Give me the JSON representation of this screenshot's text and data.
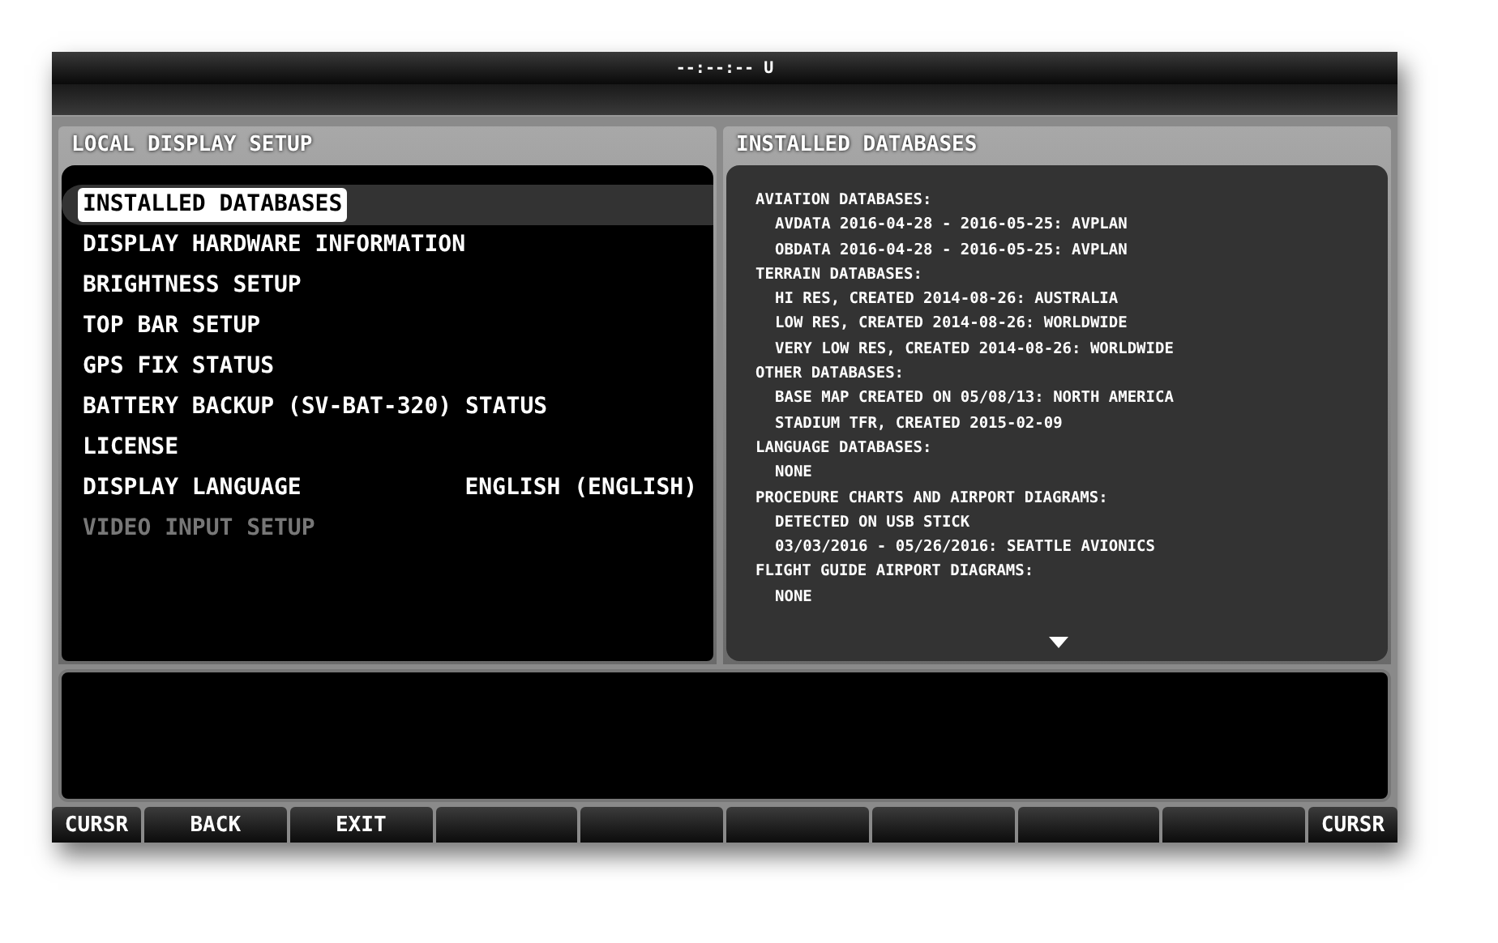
{
  "top_bar": {
    "clock": "--:--:-- U"
  },
  "left_panel": {
    "title": "LOCAL DISPLAY SETUP",
    "items": [
      {
        "label": "INSTALLED DATABASES",
        "selected": true,
        "disabled": false
      },
      {
        "label": "DISPLAY HARDWARE INFORMATION",
        "selected": false,
        "disabled": false
      },
      {
        "label": "BRIGHTNESS SETUP",
        "selected": false,
        "disabled": false
      },
      {
        "label": "TOP BAR SETUP",
        "selected": false,
        "disabled": false
      },
      {
        "label": "GPS FIX STATUS",
        "selected": false,
        "disabled": false
      },
      {
        "label": "BATTERY BACKUP (SV-BAT-320) STATUS",
        "selected": false,
        "disabled": false
      },
      {
        "label": "LICENSE",
        "selected": false,
        "disabled": false
      },
      {
        "label": "DISPLAY LANGUAGE",
        "value": "ENGLISH (ENGLISH)",
        "selected": false,
        "disabled": false
      },
      {
        "label": "VIDEO INPUT SETUP",
        "selected": false,
        "disabled": true
      }
    ]
  },
  "right_panel": {
    "title": "INSTALLED DATABASES",
    "lines": [
      {
        "kind": "heading",
        "text": "AVIATION DATABASES:"
      },
      {
        "kind": "entry",
        "text": "AVDATA 2016-04-28 - 2016-05-25: AVPLAN"
      },
      {
        "kind": "entry",
        "text": "OBDATA 2016-04-28 - 2016-05-25: AVPLAN"
      },
      {
        "kind": "heading",
        "text": "TERRAIN DATABASES:"
      },
      {
        "kind": "entry",
        "text": "HI RES, CREATED 2014-08-26: AUSTRALIA"
      },
      {
        "kind": "entry",
        "text": "LOW RES, CREATED 2014-08-26: WORLDWIDE"
      },
      {
        "kind": "entry",
        "text": "VERY LOW RES, CREATED 2014-08-26: WORLDWIDE"
      },
      {
        "kind": "heading",
        "text": "OTHER DATABASES:"
      },
      {
        "kind": "entry",
        "text": "BASE MAP CREATED ON 05/08/13: NORTH AMERICA"
      },
      {
        "kind": "entry",
        "text": "STADIUM TFR, CREATED 2015-02-09"
      },
      {
        "kind": "heading",
        "text": "LANGUAGE DATABASES:"
      },
      {
        "kind": "entry",
        "text": "NONE"
      },
      {
        "kind": "heading",
        "text": "PROCEDURE CHARTS AND AIRPORT DIAGRAMS:"
      },
      {
        "kind": "entry",
        "text": "DETECTED ON USB STICK"
      },
      {
        "kind": "entry",
        "text": "03/03/2016 - 05/26/2016: SEATTLE AVIONICS"
      },
      {
        "kind": "heading",
        "text": "FLIGHT GUIDE AIRPORT DIAGRAMS:"
      },
      {
        "kind": "entry",
        "text": "NONE"
      }
    ]
  },
  "softkeys": [
    {
      "kind": "edge",
      "label": "CURSR"
    },
    {
      "kind": "label",
      "label": "BACK"
    },
    {
      "kind": "label",
      "label": "EXIT"
    },
    {
      "kind": "blank"
    },
    {
      "kind": "blank"
    },
    {
      "kind": "blank"
    },
    {
      "kind": "blank"
    },
    {
      "kind": "blank"
    },
    {
      "kind": "blank"
    },
    {
      "kind": "edge",
      "label": "CURSR"
    }
  ]
}
